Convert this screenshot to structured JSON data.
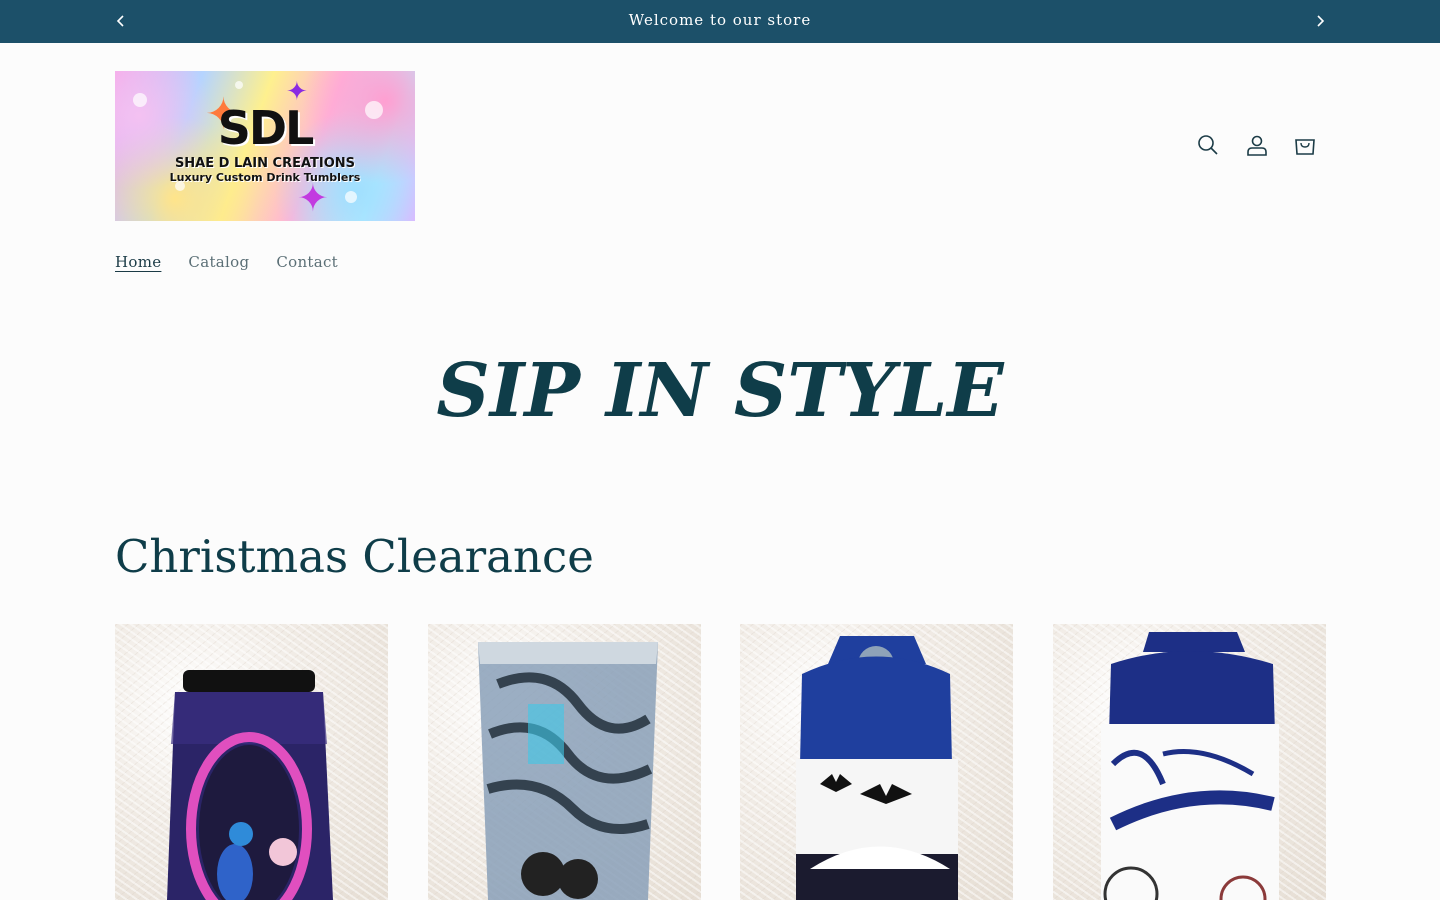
{
  "announcement": {
    "message": "Welcome to our store"
  },
  "logo": {
    "title": "SDL",
    "line1": "SHAE D LAIN CREATIONS",
    "line2": "Luxury Custom Drink Tumblers"
  },
  "header_icons": [
    "search-icon",
    "account-icon",
    "cart-icon"
  ],
  "nav": {
    "items": [
      {
        "label": "Home",
        "active": true
      },
      {
        "label": "Catalog",
        "active": false
      },
      {
        "label": "Contact",
        "active": false
      }
    ]
  },
  "hero": {
    "heading": "SIP IN STYLE"
  },
  "collection": {
    "title": "Christmas Clearance",
    "products": [
      {
        "image": "peacock-tumbler"
      },
      {
        "image": "holographic-zebra-tumbler"
      },
      {
        "image": "batman-kids-bottle"
      },
      {
        "image": "yankees-kids-bottle"
      }
    ]
  },
  "colors": {
    "announcement_bg": "#1c5069",
    "heading": "#0f3d49",
    "page_bg": "#fcfcfc"
  }
}
